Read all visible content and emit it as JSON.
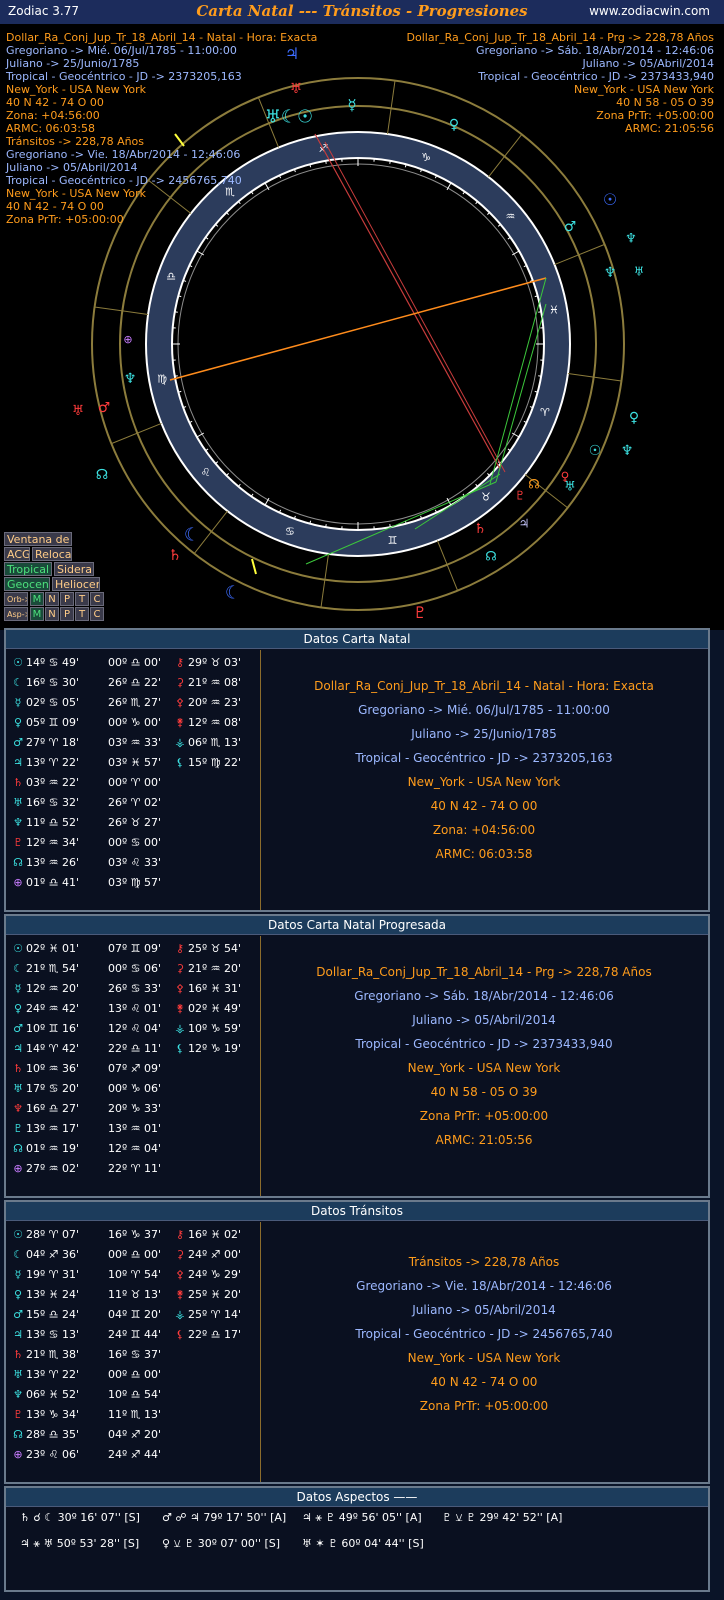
{
  "app": {
    "name": "Zodiac 3.77",
    "title": "Carta Natal --- Tránsitos - Progresiones",
    "url": "www.zodiacwin.com"
  },
  "chart_header": {
    "left": [
      {
        "text": "Dollar_Ra_Conj_Jup_Tr_18_Abril_14 - Natal - Hora: Exacta",
        "color": "#ff9c1c"
      },
      {
        "text": "Gregoriano -> Mié. 06/Jul/1785 - 11:00:00",
        "color": "#9cb8ff"
      },
      {
        "text": "Juliano -> 25/Junio/1785",
        "color": "#9cb8ff"
      },
      {
        "text": "Tropical - Geocéntrico - JD -> 2373205,163",
        "color": "#9cb8ff"
      },
      {
        "text": "New_York - USA New York",
        "color": "#ff9c1c"
      },
      {
        "text": "40 N 42 - 74 O 00",
        "color": "#ff9c1c"
      },
      {
        "text": "Zona: +04:56:00",
        "color": "#ff9c1c"
      },
      {
        "text": "ARMC: 06:03:58",
        "color": "#ff9c1c"
      },
      {
        "text": "Tránsitos -> 228,78 Años",
        "color": "#ff9c1c"
      },
      {
        "text": "Gregoriano -> Vie. 18/Abr/2014 - 12:46:06",
        "color": "#9cb8ff"
      },
      {
        "text": "Juliano -> 05/Abril/2014",
        "color": "#9cb8ff"
      },
      {
        "text": "Tropical - Geocéntrico - JD -> 2456765,740",
        "color": "#9cb8ff"
      },
      {
        "text": "New_York - USA New York",
        "color": "#ff9c1c"
      },
      {
        "text": "40 N 42 - 74 O 00",
        "color": "#ff9c1c"
      },
      {
        "text": "Zona PrTr: +05:00:00",
        "color": "#ff9c1c"
      }
    ],
    "right": [
      {
        "text": "Dollar_Ra_Conj_Jup_Tr_18_Abril_14 - Prg -> 228,78 Años",
        "color": "#ff9c1c"
      },
      {
        "text": "Gregoriano -> Sáb. 18/Abr/2014 - 12:46:06",
        "color": "#9cb8ff"
      },
      {
        "text": "Juliano -> 05/Abril/2014",
        "color": "#9cb8ff"
      },
      {
        "text": "Tropical - Geocéntrico - JD -> 2373433,940",
        "color": "#9cb8ff"
      },
      {
        "text": "New_York - USA New York",
        "color": "#ff9c1c"
      },
      {
        "text": "40 N 58 - 05 O 39",
        "color": "#ff9c1c"
      },
      {
        "text": "Zona PrTr: +05:00:00",
        "color": "#ff9c1c"
      },
      {
        "text": "ARMC: 21:05:56",
        "color": "#ff9c1c"
      }
    ]
  },
  "wheel_glyphs": [
    {
      "g": "♃",
      "c": "#3c6cff"
    },
    {
      "g": "♅",
      "c": "#ff3c3c"
    },
    {
      "g": "♅☾☉",
      "c": "#3ce0e0"
    },
    {
      "g": "☿",
      "c": "#3ce0e0"
    },
    {
      "g": "♀",
      "c": "#3ce0e0"
    },
    {
      "g": "☉",
      "c": "#3c6cff"
    },
    {
      "g": "♂",
      "c": "#3ce0e0"
    },
    {
      "g": "♆",
      "c": "#3ce0e0"
    },
    {
      "g": "♆",
      "c": "#3ce0e0"
    },
    {
      "g": "♅",
      "c": "#3ce0e0"
    },
    {
      "g": "⊕",
      "c": "#c87cff"
    },
    {
      "g": "♆",
      "c": "#3ce0e0"
    },
    {
      "g": "♂",
      "c": "#ff3c3c"
    },
    {
      "g": "♅",
      "c": "#ff3c3c"
    },
    {
      "g": "♀",
      "c": "#3ce0e0"
    },
    {
      "g": "☉",
      "c": "#3ce0e0"
    },
    {
      "g": "♆",
      "c": "#3ce0e0"
    },
    {
      "g": "♀",
      "c": "#ff3c3c"
    },
    {
      "g": "♅",
      "c": "#3ce0e0"
    },
    {
      "g": "☊",
      "c": "#3ce0e0"
    },
    {
      "g": "☊",
      "c": "#ff9c1c"
    },
    {
      "g": "♇",
      "c": "#ff3c3c"
    },
    {
      "g": "♄",
      "c": "#ff3c3c"
    },
    {
      "g": "♃",
      "c": "#c8c8ff"
    },
    {
      "g": "☊",
      "c": "#3ce0e0"
    },
    {
      "g": "☾",
      "c": "#3c6cff"
    },
    {
      "g": "♄",
      "c": "#ff3c3c"
    },
    {
      "g": "☾",
      "c": "#3c6cff"
    },
    {
      "g": "♇",
      "c": "#ff3c3c"
    }
  ],
  "side_buttons": {
    "ventana": "Ventana de Ciclos",
    "acg": "ACG",
    "relocacion": "Relocación",
    "tropical": "Tropical",
    "sideral": "Sideral",
    "geocen": "Geocen",
    "heliocen": "Heliocen",
    "orb_label": "Orb->",
    "asp_label": "Asp->",
    "letters": [
      "M",
      "N",
      "P",
      "T",
      "C"
    ]
  },
  "natal": {
    "title": "Datos Carta Natal",
    "col1": [
      [
        "☉",
        "14º ♋ 49'",
        "#3ce0e0"
      ],
      [
        "☾",
        "16º ♋ 30'",
        "#3ce0e0"
      ],
      [
        "☿",
        "02º ♋ 05'",
        "#3ce0e0"
      ],
      [
        "♀",
        "05º ♊ 09'",
        "#3ce0e0"
      ],
      [
        "♂",
        "27º ♈ 18'",
        "#3ce0e0"
      ],
      [
        "♃",
        "13º ♈ 22'",
        "#3ce0e0"
      ],
      [
        "♄",
        "03º ♒ 22'",
        "#ff3c3c"
      ],
      [
        "♅",
        "16º ♋ 32'",
        "#3ce0e0"
      ],
      [
        "♆",
        "11º ♎ 52'",
        "#3ce0e0"
      ],
      [
        "♇",
        "12º ♒ 34'",
        "#ff3c3c"
      ],
      [
        "☊",
        "13º ♒ 26'",
        "#3ce0e0"
      ],
      [
        "⊕",
        "01º ♎ 41'",
        "#c87cff"
      ]
    ],
    "col2": [
      "00º ♎ 00'",
      "26º ♎ 22'",
      "26º ♏ 27'",
      "00º ♑ 00'",
      "03º ♒ 33'",
      "03º ♓ 57'",
      "00º ♈ 00'",
      "26º ♈ 02'",
      "26º ♉ 27'",
      "00º ♋ 00'",
      "03º ♌ 33'",
      "03º ♍ 57'"
    ],
    "col3": [
      [
        "⚷",
        "29º ♉ 03'",
        "#ff3c3c"
      ],
      [
        "⚳",
        "21º ♒ 08'",
        "#ff3c3c"
      ],
      [
        "⚴",
        "20º ♒ 23'",
        "#ff3c3c"
      ],
      [
        "⚵",
        "12º ♒ 08'",
        "#ff3c3c"
      ],
      [
        "⚶",
        "06º ♏ 13'",
        "#3ce0e0"
      ],
      [
        "⚸",
        "15º ♍ 22'",
        "#3ce0e0"
      ]
    ],
    "info": [
      {
        "text": "Dollar_Ra_Conj_Jup_Tr_18_Abril_14 - Natal - Hora: Exacta",
        "color": "#ff9c1c"
      },
      {
        "text": "Gregoriano -> Mié. 06/Jul/1785 - 11:00:00",
        "color": "#9cb8ff"
      },
      {
        "text": "Juliano -> 25/Junio/1785",
        "color": "#9cb8ff"
      },
      {
        "text": "Tropical - Geocéntrico - JD -> 2373205,163",
        "color": "#9cb8ff"
      },
      {
        "text": "New_York - USA New York",
        "color": "#ff9c1c"
      },
      {
        "text": "40 N 42 - 74 O 00",
        "color": "#ff9c1c"
      },
      {
        "text": "Zona: +04:56:00",
        "color": "#ff9c1c"
      },
      {
        "text": "ARMC: 06:03:58",
        "color": "#ff9c1c"
      }
    ]
  },
  "progressed": {
    "title": "Datos Carta Natal Progresada",
    "col1": [
      [
        "☉",
        "02º ♓ 01'",
        "#3ce0e0"
      ],
      [
        "☾",
        "21º ♏ 54'",
        "#3ce0e0"
      ],
      [
        "☿",
        "12º ♒ 20'",
        "#3ce0e0"
      ],
      [
        "♀",
        "24º ♒ 42'",
        "#3ce0e0"
      ],
      [
        "♂",
        "10º ♊ 16'",
        "#3ce0e0"
      ],
      [
        "♃",
        "14º ♈ 42'",
        "#3ce0e0"
      ],
      [
        "♄",
        "10º ♒ 36'",
        "#ff3c3c"
      ],
      [
        "♅",
        "17º ♋ 20'",
        "#3ce0e0"
      ],
      [
        "♆",
        "16º ♎ 27'",
        "#ff3c3c"
      ],
      [
        "♇",
        "13º ♒ 17'",
        "#3ce0e0"
      ],
      [
        "☊",
        "01º ♒ 19'",
        "#3ce0e0"
      ],
      [
        "⊕",
        "27º ♒ 02'",
        "#c87cff"
      ]
    ],
    "col2": [
      "07º ♊ 09'",
      "00º ♋ 06'",
      "26º ♋ 33'",
      "13º ♌ 01'",
      "12º ♌ 04'",
      "22º ♎ 11'",
      "07º ♐ 09'",
      "00º ♑ 06'",
      "20º ♑ 33'",
      "13º ♒ 01'",
      "12º ♒ 04'",
      "22º ♈ 11'"
    ],
    "col3": [
      [
        "⚷",
        "25º ♉ 54'",
        "#ff3c3c"
      ],
      [
        "⚳",
        "21º ♒ 20'",
        "#ff3c3c"
      ],
      [
        "⚴",
        "16º ♓ 31'",
        "#ff3c3c"
      ],
      [
        "⚵",
        "02º ♓ 49'",
        "#ff3c3c"
      ],
      [
        "⚶",
        "10º ♑ 59'",
        "#3ce0e0"
      ],
      [
        "⚸",
        "12º ♑ 19'",
        "#3ce0e0"
      ]
    ],
    "info": [
      {
        "text": "Dollar_Ra_Conj_Jup_Tr_18_Abril_14 - Prg -> 228,78 Años",
        "color": "#ff9c1c"
      },
      {
        "text": "Gregoriano -> Sáb. 18/Abr/2014 - 12:46:06",
        "color": "#9cb8ff"
      },
      {
        "text": "Juliano -> 05/Abril/2014",
        "color": "#9cb8ff"
      },
      {
        "text": "Tropical - Geocéntrico - JD -> 2373433,940",
        "color": "#9cb8ff"
      },
      {
        "text": "New_York - USA New York",
        "color": "#ff9c1c"
      },
      {
        "text": "40 N 58 - 05 O 39",
        "color": "#ff9c1c"
      },
      {
        "text": "Zona PrTr: +05:00:00",
        "color": "#ff9c1c"
      },
      {
        "text": "ARMC: 21:05:56",
        "color": "#ff9c1c"
      }
    ]
  },
  "transits": {
    "title": "Datos Tránsitos",
    "col1": [
      [
        "☉",
        "28º ♈ 07'",
        "#3ce0e0"
      ],
      [
        "☾",
        "04º ♐ 36'",
        "#3ce0e0"
      ],
      [
        "☿",
        "19º ♈ 31'",
        "#3ce0e0"
      ],
      [
        "♀",
        "13º ♓ 24'",
        "#3ce0e0"
      ],
      [
        "♂",
        "15º ♎ 24'",
        "#3ce0e0"
      ],
      [
        "♃",
        "13º ♋ 13'",
        "#3ce0e0"
      ],
      [
        "♄",
        "21º ♏ 38'",
        "#ff3c3c"
      ],
      [
        "♅",
        "13º ♈ 22'",
        "#3ce0e0"
      ],
      [
        "♆",
        "06º ♓ 52'",
        "#3ce0e0"
      ],
      [
        "♇",
        "13º ♑ 34'",
        "#ff3c3c"
      ],
      [
        "☊",
        "28º ♎ 35'",
        "#3ce0e0"
      ],
      [
        "⊕",
        "23º ♌ 06'",
        "#c87cff"
      ]
    ],
    "col2": [
      "16º ♑ 37'",
      "00º ♎ 00'",
      "10º ♈ 54'",
      "11º ♉ 13'",
      "04º ♊ 20'",
      "24º ♊ 44'",
      "16º ♋ 37'",
      "00º ♎ 00'",
      "10º ♎ 54'",
      "11º ♏ 13'",
      "04º ♐ 20'",
      "24º ♐ 44'"
    ],
    "col3": [
      [
        "⚷",
        "16º ♓ 02'",
        "#ff3c3c"
      ],
      [
        "⚳",
        "24º ♐ 00'",
        "#ff3c3c"
      ],
      [
        "⚴",
        "24º ♑ 29'",
        "#ff3c3c"
      ],
      [
        "⚵",
        "25º ♓ 20'",
        "#ff3c3c"
      ],
      [
        "⚶",
        "25º ♈ 14'",
        "#3ce0e0"
      ],
      [
        "⚸",
        "22º ♎ 17'",
        "#ff3c3c"
      ]
    ],
    "info": [
      {
        "text": "Tránsitos -> 228,78 Años",
        "color": "#ff9c1c"
      },
      {
        "text": "Gregoriano -> Vie. 18/Abr/2014 - 12:46:06",
        "color": "#9cb8ff"
      },
      {
        "text": "Juliano -> 05/Abril/2014",
        "color": "#9cb8ff"
      },
      {
        "text": "Tropical - Geocéntrico - JD -> 2456765,740",
        "color": "#9cb8ff"
      },
      {
        "text": "New_York - USA New York",
        "color": "#ff9c1c"
      },
      {
        "text": "40 N 42 - 74 O 00",
        "color": "#ff9c1c"
      },
      {
        "text": "Zona PrTr: +05:00:00",
        "color": "#ff9c1c"
      }
    ]
  },
  "aspects": {
    "title": "Datos Aspectos ——",
    "items": [
      {
        "text": "♄ ☌ ☾ 30º 16' 07'' [S]"
      },
      {
        "text": "♂ ☍ ♃ 79º 17' 50'' [A]"
      },
      {
        "text": "♃ ⚹ ♇ 49º 56' 05'' [A]"
      },
      {
        "text": "♇ ⚺ ♇ 29º 42' 52'' [A]"
      },
      {
        "text": "♃ ⚹ ♅ 50º 53' 28'' [S]"
      },
      {
        "text": "♀ ⚺ ♇ 30º 07' 00'' [S]"
      },
      {
        "text": "♅ ✶ ♇ 60º 04' 44'' [S]"
      }
    ]
  }
}
